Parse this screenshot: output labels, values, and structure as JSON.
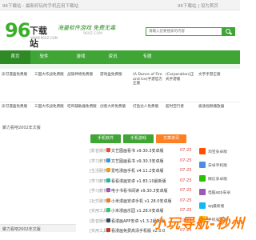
{
  "topbar": {
    "left_text": "96下载站 - 最新好玩的手机应用下载站",
    "right_text": "96下载站 | 设为首页"
  },
  "logo": {
    "number": "96",
    "name": "下载站",
    "url": "WWW.96XZ.COM"
  },
  "slogan": {
    "main": "海量软件游戏 免费无毒",
    "sub": "96XZ.COM"
  },
  "search": {
    "placeholder": "请输入您要搜索的内容"
  },
  "nav": [
    {
      "label": "首页",
      "active": true
    },
    {
      "label": "软件",
      "active": false
    },
    {
      "label": "游戏",
      "active": false
    },
    {
      "label": "资讯",
      "active": false
    },
    {
      "label": "专题",
      "active": false
    }
  ],
  "apps_row1": [
    {
      "title": "乐可漫画免费版",
      "color": "#5cb85c"
    },
    {
      "title": "三国大作战免费版",
      "color": "#f0ad4e"
    },
    {
      "title": "战旗神将免费版",
      "color": "#d9534f"
    },
    {
      "title": "游戏盒免费版",
      "color": "#5bc0de"
    },
    {
      "title": "(A Dance of Fire and Ice)手游官方正版",
      "color": "#9370db"
    },
    {
      "title": "(Corporation)正式手游版",
      "color": "#337ab7"
    },
    {
      "title": "文字手游正版",
      "color": "#e67e22"
    }
  ],
  "apps_row2": [
    {
      "title": "乐可漫画免费版",
      "color": "#5cb85c"
    },
    {
      "title": "三国大作战免费版",
      "color": "#f0ad4e"
    },
    {
      "title": "吃鸡辅助器免费版",
      "color": "#d9534f"
    },
    {
      "title": "创意大师免费版",
      "color": "#5bc0de"
    },
    {
      "title": "打鱼达人免费版",
      "color": "#9370db"
    },
    {
      "title": "超时空行者",
      "color": "#337ab7"
    },
    {
      "title": "极速视频播放器",
      "color": "#e67e22"
    }
  ],
  "leftlist": {
    "first": "聚力看吧2002年文版",
    "bar": "聚力看吧2002年文版"
  },
  "tabs": [
    {
      "label": "手机软件",
      "style": "green"
    },
    {
      "label": "手机游戏",
      "style": "green"
    },
    {
      "label": "文章资讯",
      "style": "orange"
    }
  ],
  "downloads": [
    {
      "cat": "[影音娱乐]",
      "name": "文艺图画看书 v9.30.3安卓版",
      "date": "07-25",
      "color": "#e74c3c"
    },
    {
      "cat": "[学习教育]",
      "name": "文艺图画看书 v9.30.3安卓版",
      "date": "07-25",
      "color": "#3498db"
    },
    {
      "cat": "[生活服务]",
      "name": "爱吃漫画手机 v4.11.2安卓版",
      "date": "07-25",
      "color": "#f39c12"
    },
    {
      "cat": "[学习教育]",
      "name": "看看漫画安卓 v1.83.10最新版",
      "date": "07-25",
      "color": "#1abc9c"
    },
    {
      "cat": "[学习教育]",
      "name": "电子书看书阅读 v9.30.3安卓版",
      "date": "07-25",
      "color": "#9b59b6"
    },
    {
      "cat": "[社交聊天]",
      "name": "小米漫画安卓手机 v1.28.0安卓版",
      "date": "07-25",
      "color": "#e67e22"
    },
    {
      "cat": "[实用工具]",
      "name": "小米漫画乐园 v1.28.0安卓版",
      "date": "07-25",
      "color": "#2ecc71"
    },
    {
      "cat": "[影音娱乐]",
      "name": "看漫画APP安卓 v1.3.2最新版",
      "date": "07-25",
      "color": "#34495e"
    },
    {
      "cat": "[实用工具]",
      "name": "看漫画免费高清手机版 v2.0.0",
      "date": "07-25",
      "color": "#c0392b"
    }
  ],
  "right_panel": [
    {
      "title": "淘宝安卓版",
      "color": "#ff5000"
    },
    {
      "title": "安卓手机版",
      "color": "#4a90e2"
    },
    {
      "title": "微信安卓版",
      "color": "#2dc100"
    },
    {
      "title": "电脑app安卓",
      "color": "#9b59b6"
    },
    {
      "title": "qq最新版",
      "color": "#12b7f5"
    },
    {
      "title": "手机安卓版",
      "color": "#f1c40f"
    }
  ],
  "watermark": "小玩导航-秒州"
}
